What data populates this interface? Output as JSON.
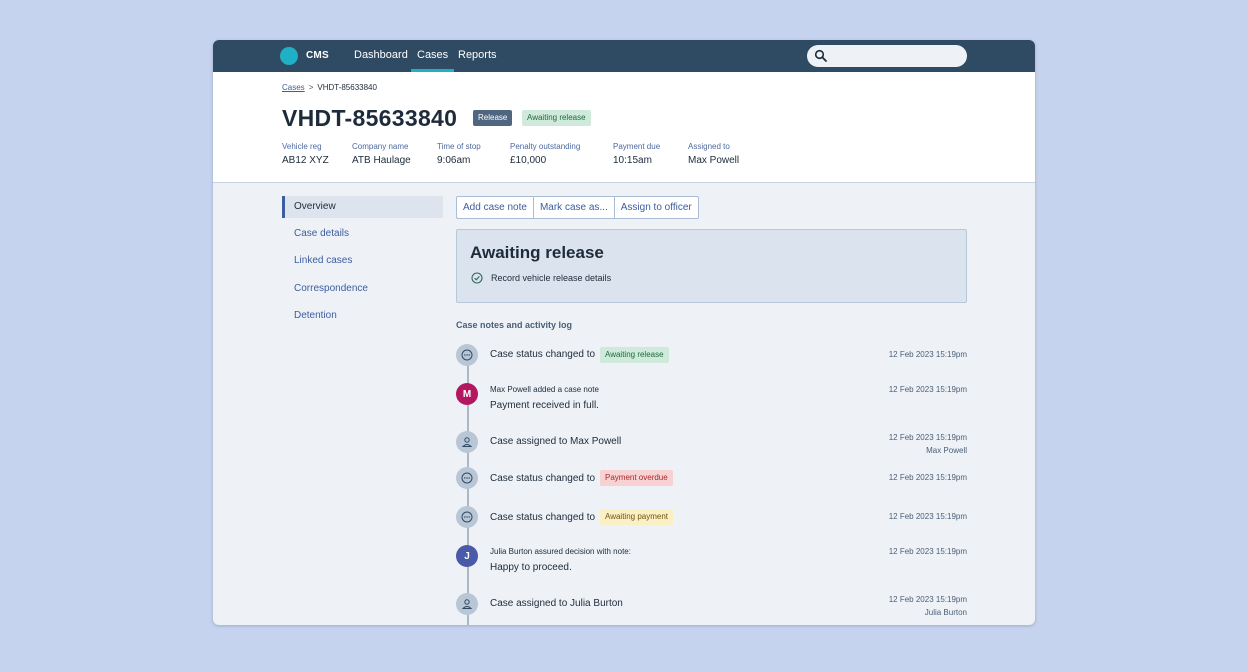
{
  "nav": {
    "brand": "CMS",
    "items": [
      {
        "label": "Dashboard"
      },
      {
        "label": "Cases"
      },
      {
        "label": "Reports"
      }
    ],
    "search_placeholder": ""
  },
  "header": {
    "breadcrumb": {
      "link": "Cases",
      "separator": ">",
      "current": "VHDT-85633840"
    },
    "case_id": "VHDT-85633840",
    "tags": [
      "Release",
      "Awaiting release"
    ],
    "meta": [
      {
        "label": "Vehicle reg",
        "value": "AB12 XYZ"
      },
      {
        "label": "Company name",
        "value": "ATB Haulage"
      },
      {
        "label": "Time of stop",
        "value": "9:06am"
      },
      {
        "label": "Penalty outstanding",
        "value": "£10,000"
      },
      {
        "label": "Payment due",
        "value": "10:15am"
      },
      {
        "label": "Assigned to",
        "value": "Max Powell"
      }
    ]
  },
  "sidebar": {
    "items": [
      {
        "label": "Overview"
      },
      {
        "label": "Case details"
      },
      {
        "label": "Linked cases"
      },
      {
        "label": "Correspondence"
      },
      {
        "label": "Detention"
      }
    ]
  },
  "actions": {
    "add_note": "Add case note",
    "mark_case": "Mark case as...",
    "assign": "Assign to officer"
  },
  "status_panel": {
    "title": "Awaiting release",
    "task": "Record vehicle release details"
  },
  "activity": {
    "title": "Case notes and activity log",
    "entries": [
      {
        "text": "Case status changed to",
        "badge": "Awaiting release",
        "time": "12 Feb 2023 15:19pm"
      },
      {
        "avatar": "M",
        "small": "Max Powell added a case note",
        "text": "Payment received in full.",
        "time": "12 Feb 2023 15:19pm"
      },
      {
        "text": "Case assigned to Max Powell",
        "time": "12 Feb 2023 15:19pm",
        "sub": "Max Powell"
      },
      {
        "text": "Case status changed to",
        "badge": "Payment overdue",
        "time": "12 Feb 2023 15:19pm"
      },
      {
        "text": "Case status changed to",
        "badge": "Awaiting payment",
        "time": "12 Feb 2023 15:19pm"
      },
      {
        "avatar": "J",
        "small": "Julia Burton assured decision with note:",
        "text": "Happy to proceed.",
        "time": "12 Feb 2023 15:19pm"
      },
      {
        "text": "Case assigned to Julia Burton",
        "time": "12 Feb 2023 15:19pm",
        "sub": "Julia Burton"
      }
    ]
  },
  "colors": {
    "navbar": "#2f4a63",
    "accent": "#1fb0c6",
    "link": "#3c5d9e",
    "avatar_m": "#b3175f",
    "avatar_j": "#4a5aa8"
  }
}
